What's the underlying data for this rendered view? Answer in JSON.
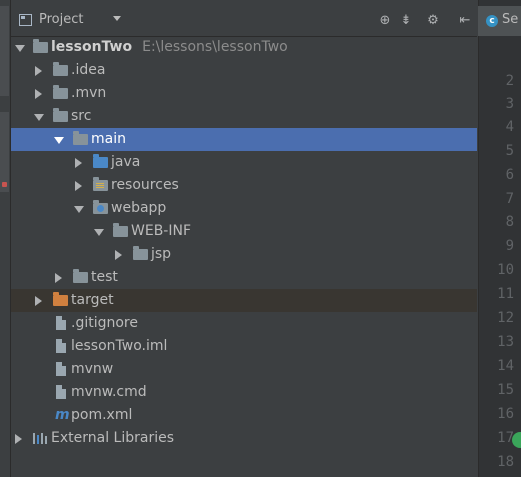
{
  "project_panel": {
    "title": "Project",
    "header_icons": [
      "target-icon",
      "collapse-icon",
      "gear-icon",
      "hide-icon"
    ]
  },
  "tree": [
    {
      "label": "lessonTwo",
      "path": "E:\\lessons\\lessonTwo",
      "icon": "module-folder",
      "state": "expanded"
    },
    {
      "label": ".idea",
      "icon": "folder",
      "state": "collapsed"
    },
    {
      "label": ".mvn",
      "icon": "folder",
      "state": "collapsed"
    },
    {
      "label": "src",
      "icon": "folder",
      "state": "expanded"
    },
    {
      "label": "main",
      "icon": "folder",
      "state": "expanded",
      "selected": true
    },
    {
      "label": "java",
      "icon": "source-folder",
      "state": "collapsed"
    },
    {
      "label": "resources",
      "icon": "resources-folder",
      "state": "collapsed"
    },
    {
      "label": "webapp",
      "icon": "web-folder",
      "state": "expanded"
    },
    {
      "label": "WEB-INF",
      "icon": "folder",
      "state": "expanded"
    },
    {
      "label": "jsp",
      "icon": "folder",
      "state": "collapsed"
    },
    {
      "label": "test",
      "icon": "folder",
      "state": "collapsed"
    },
    {
      "label": "target",
      "icon": "excluded-folder",
      "state": "collapsed"
    },
    {
      "label": ".gitignore",
      "icon": "file"
    },
    {
      "label": "lessonTwo.iml",
      "icon": "file"
    },
    {
      "label": "mvnw",
      "icon": "file"
    },
    {
      "label": "mvnw.cmd",
      "icon": "file"
    },
    {
      "label": "pom.xml",
      "icon": "maven-file"
    },
    {
      "label": "External Libraries",
      "icon": "library",
      "state": "collapsed"
    }
  ],
  "editor": {
    "tab_label": "Se",
    "line_numbers": [
      "2",
      "3",
      "4",
      "5",
      "6",
      "7",
      "8",
      "9",
      "10",
      "11",
      "12",
      "13",
      "14",
      "15",
      "16",
      "17",
      "18"
    ]
  },
  "colors": {
    "background": "#3c3f41",
    "selection": "#4b6eaf",
    "gutter": "#313335",
    "source_folder": "#4a88c7",
    "excluded_folder": "#d0803f"
  }
}
